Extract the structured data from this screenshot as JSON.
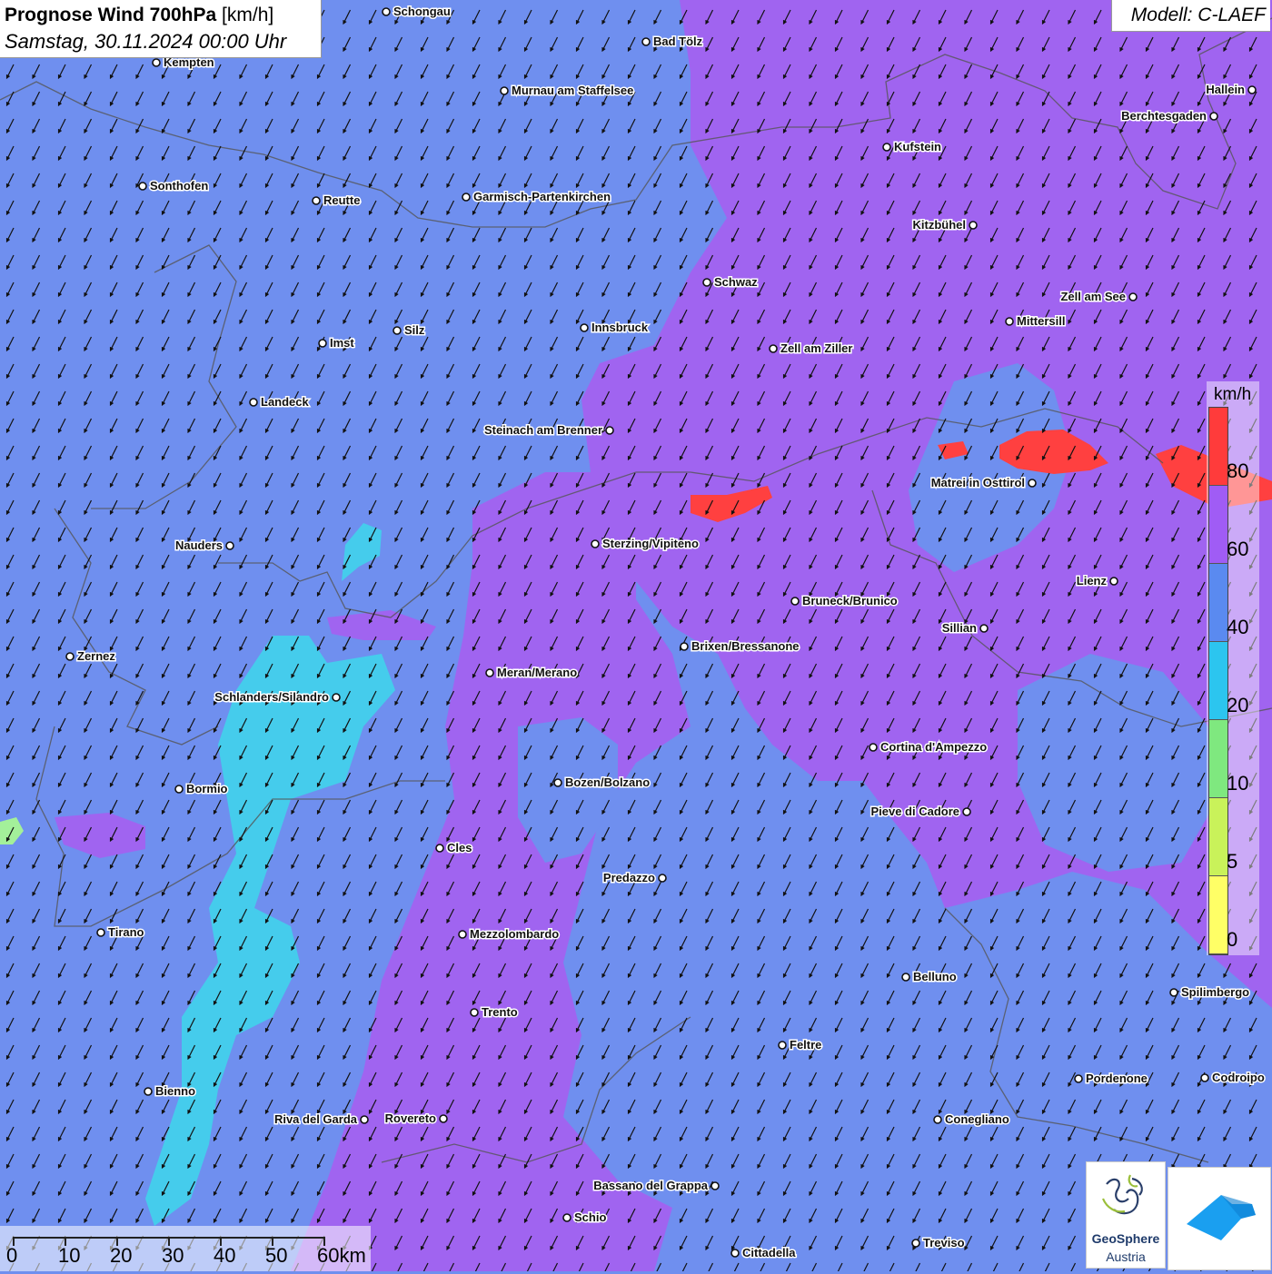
{
  "title": {
    "main_bold": "Prognose Wind 700hPa",
    "main_unit": " [km/h]",
    "subtitle": "Samstag, 30.11.2024 00:00 Uhr",
    "model": "Modell: C-LAEF"
  },
  "legend": {
    "unit": "km/h",
    "ticks": [
      "80",
      "60",
      "40",
      "20",
      "10",
      "5",
      "0"
    ],
    "colors": [
      "#ff3b3b",
      "#a05cf5",
      "#5a8af0",
      "#2cc5ef",
      "#7fe87f",
      "#c9f25a",
      "#ffff66"
    ]
  },
  "scale_bar": {
    "labels": [
      "0",
      "10",
      "20",
      "30",
      "40",
      "50",
      "60km"
    ]
  },
  "logos": {
    "geosphere_line1": "GeoSphere",
    "geosphere_line2": "Austria"
  },
  "colors": {
    "wind_40_60": "#6f8fef",
    "wind_60_80": "#a064f0",
    "wind_20_40": "#45ccec",
    "wind_80_plus": "#ff4040",
    "arrow": "#111111",
    "border": "#555555"
  },
  "wind_arrow_direction": "from north-east",
  "cities": [
    "Schongau",
    "Bad Tölz",
    "Kempten",
    "Murnau am Staffelsee",
    "Hallein",
    "Berchtesgaden",
    "Kufstein",
    "Sonthofen",
    "Reutte",
    "Garmisch-Partenkirchen",
    "Kitzbühel",
    "Schwaz",
    "Zell am See",
    "Mittersill",
    "Innsbruck",
    "Silz",
    "Imst",
    "Zell am Ziller",
    "Landeck",
    "Steinach am Brenner",
    "Matrei in Osttirol",
    "Nauders",
    "Sterzing/Vipiteno",
    "Lienz",
    "Bruneck/Brunico",
    "Sillian",
    "Zernez",
    "Brixen/Bressanone",
    "Meran/Merano",
    "Schlanders/Silandro",
    "Cortina d'Ampezzo",
    "Bozen/Bolzano",
    "Bormio",
    "Pieve di Cadore",
    "Cles",
    "Predazzo",
    "Tirano",
    "Mezzolombardo",
    "Belluno",
    "Spilimbergo",
    "Trento",
    "Feltre",
    "Pordenone",
    "Codroipo",
    "Bienno",
    "Riva del Garda",
    "Rovereto",
    "Conegliano",
    "Bassano del Grappa",
    "Schio",
    "Treviso",
    "Cittadella"
  ]
}
